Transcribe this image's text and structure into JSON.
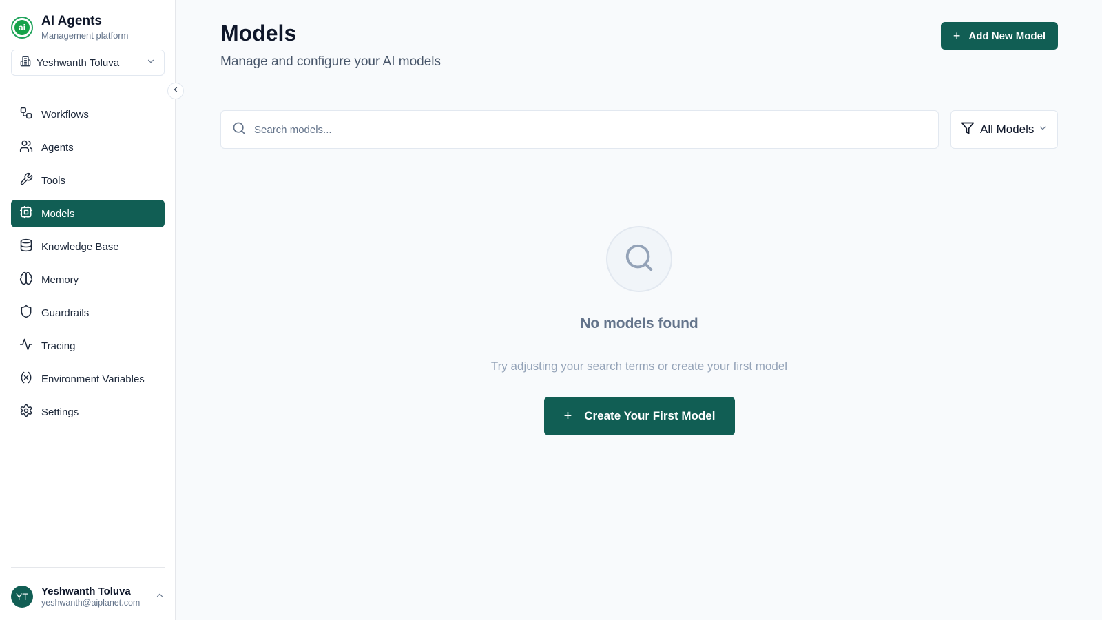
{
  "brand": {
    "logo_text": "ai",
    "title": "AI Agents",
    "subtitle": "Management platform"
  },
  "org_selector": {
    "selected": "Yeshwanth Toluva",
    "icon": "building-icon"
  },
  "sidebar": {
    "items": [
      {
        "label": "Workflows",
        "icon": "workflow-icon",
        "active": false
      },
      {
        "label": "Agents",
        "icon": "users-icon",
        "active": false
      },
      {
        "label": "Tools",
        "icon": "wrench-icon",
        "active": false
      },
      {
        "label": "Models",
        "icon": "cpu-icon",
        "active": true
      },
      {
        "label": "Knowledge Base",
        "icon": "database-icon",
        "active": false
      },
      {
        "label": "Memory",
        "icon": "brain-icon",
        "active": false
      },
      {
        "label": "Guardrails",
        "icon": "shield-icon",
        "active": false
      },
      {
        "label": "Tracing",
        "icon": "activity-icon",
        "active": false
      },
      {
        "label": "Environment Variables",
        "icon": "variable-icon",
        "active": false
      },
      {
        "label": "Settings",
        "icon": "gear-icon",
        "active": false
      }
    ]
  },
  "user": {
    "initials": "YT",
    "name": "Yeshwanth Toluva",
    "email": "yeshwanth@aiplanet.com"
  },
  "header": {
    "title": "Models",
    "subtitle": "Manage and configure your AI models",
    "add_button_label": "Add New Model"
  },
  "search": {
    "placeholder": "Search models...",
    "value": ""
  },
  "filter": {
    "selected": "All Models"
  },
  "empty_state": {
    "title": "No models found",
    "subtitle": "Try adjusting your search terms or create your first model",
    "button_label": "Create Your First Model"
  },
  "colors": {
    "accent": "#115e54",
    "brand_green": "#16a34a"
  }
}
